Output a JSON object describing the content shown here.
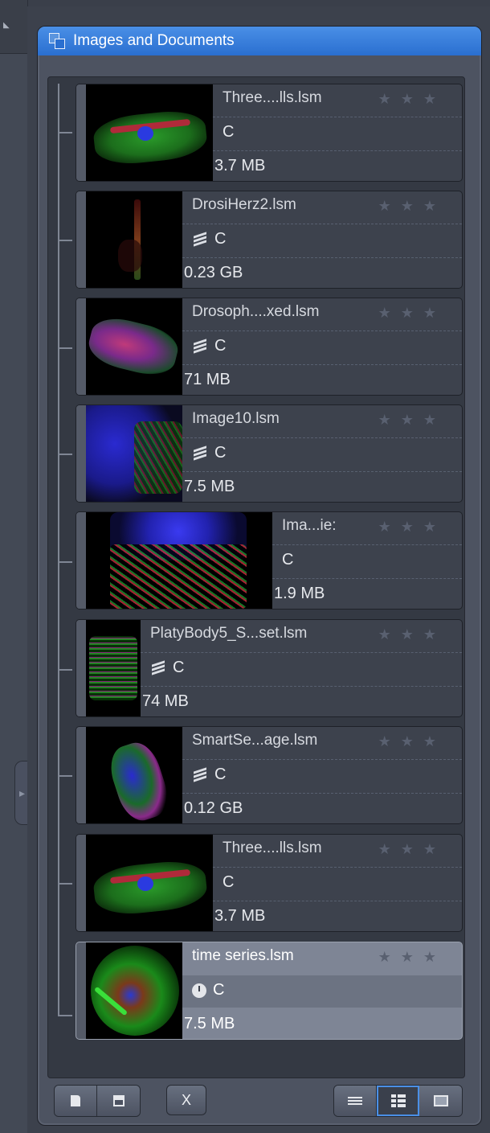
{
  "panel": {
    "title": "Images and Documents"
  },
  "items": [
    {
      "name": "Three....lls.lsm",
      "channel": "C",
      "size": "3.7 MB",
      "stars": "★★★",
      "stacked": false,
      "timeseries": false
    },
    {
      "name": "DrosiHerz2.lsm",
      "channel": "C",
      "size": "0.23 GB",
      "stars": "★★★",
      "stacked": true,
      "timeseries": false
    },
    {
      "name": "Drosoph....xed.lsm",
      "channel": "C",
      "size": "71 MB",
      "stars": "★★★",
      "stacked": true,
      "timeseries": false
    },
    {
      "name": "Image10.lsm",
      "channel": "C",
      "size": "7.5 MB",
      "stars": "★★★",
      "stacked": true,
      "timeseries": false
    },
    {
      "name": "Ima...ie:",
      "channel": "C",
      "size": "1.9 MB",
      "stars": "★★★",
      "stacked": false,
      "timeseries": false
    },
    {
      "name": "PlatyBody5_S...set.lsm",
      "channel": "C",
      "size": "74 MB",
      "stars": "★★★",
      "stacked": true,
      "timeseries": false
    },
    {
      "name": "SmartSe...age.lsm",
      "channel": "C",
      "size": "0.12 GB",
      "stars": "★★★",
      "stacked": true,
      "timeseries": false
    },
    {
      "name": "Three....lls.lsm",
      "channel": "C",
      "size": "3.7 MB",
      "stars": "★★★",
      "stacked": false,
      "timeseries": false
    },
    {
      "name": "time series.lsm",
      "channel": "C",
      "size": "7.5 MB",
      "stars": "★★★",
      "stacked": false,
      "timeseries": true,
      "selected": true
    }
  ],
  "toolbar": {
    "close_label": "X"
  },
  "colors": {
    "header_blue": "#2a6fd0",
    "selected_row": "#7e8595",
    "view_toggle_active": "#4a8fe6"
  },
  "icons": [
    "images-documents-icon",
    "new-document-icon",
    "save-icon",
    "list-view-icon",
    "detail-view-icon",
    "gallery-view-icon",
    "z-stack-icon",
    "time-series-icon",
    "star-icon"
  ]
}
